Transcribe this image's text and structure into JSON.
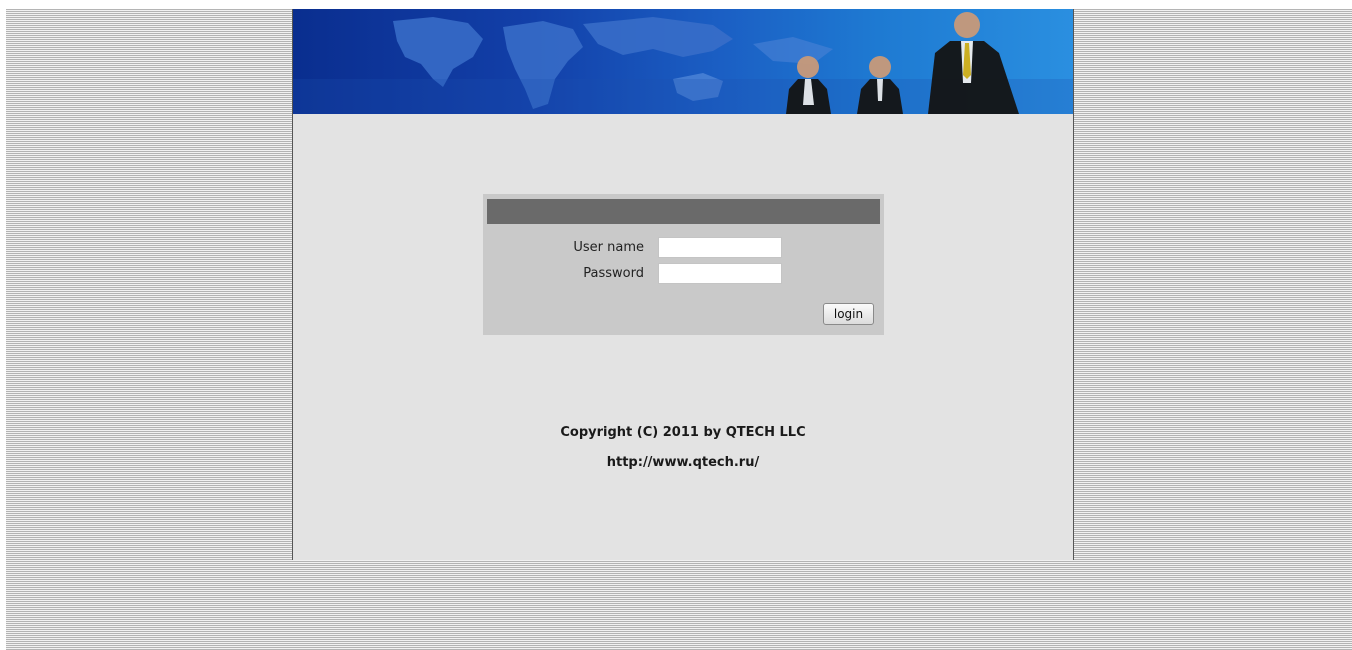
{
  "login": {
    "username_label": "User name",
    "username_value": "",
    "password_label": "Password",
    "password_value": "",
    "button_label": "login"
  },
  "footer": {
    "copyright": "Copyright (C) 2011 by QTECH LLC",
    "url": "http://www.qtech.ru/"
  },
  "colors": {
    "background_stripe_dark": "#b4b4b4",
    "background_stripe_light": "#f2f2f2",
    "page_bg": "#e3e3e3",
    "login_box_bg": "#c9c9c9",
    "login_header_bg": "#6a6a6a",
    "banner_blue": "#1b5fc4"
  },
  "icons": {
    "banner": "world-map-business-people-banner"
  }
}
